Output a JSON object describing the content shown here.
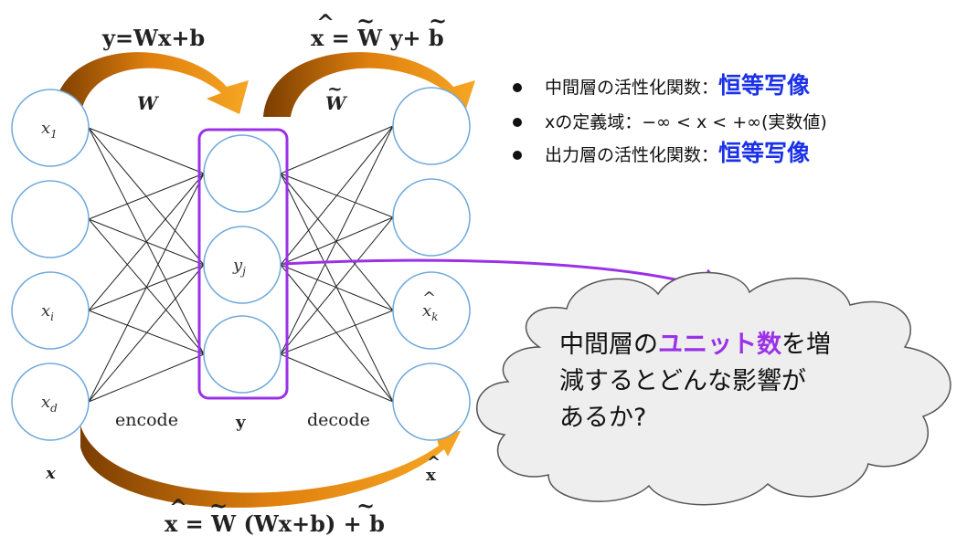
{
  "formulas": {
    "encode": "y=Wx+b",
    "decode_lhs": "x = W y+ b",
    "full": "x = W (Wx+b) + b"
  },
  "weights": {
    "encoder": "W",
    "decoder": "W"
  },
  "input_layer": {
    "nodes": [
      {
        "label": "x",
        "sub": "1"
      },
      {
        "label": "",
        "sub": ""
      },
      {
        "label": "x",
        "sub": "i"
      },
      {
        "label": "x",
        "sub": "d"
      }
    ],
    "name": "x"
  },
  "hidden_layer": {
    "nodes": [
      {
        "label": "",
        "sub": ""
      },
      {
        "label": "y",
        "sub": "j"
      },
      {
        "label": "",
        "sub": ""
      }
    ],
    "name": "y"
  },
  "output_layer": {
    "nodes": [
      {
        "label": "",
        "sub": ""
      },
      {
        "label": "",
        "sub": ""
      },
      {
        "label": "x",
        "sub": "k"
      },
      {
        "label": "",
        "sub": ""
      }
    ],
    "name": "x"
  },
  "section_labels": {
    "encode": "encode",
    "decode": "decode"
  },
  "bullets": [
    {
      "text": "中間層の活性化関数：",
      "highlight": "恒等写像"
    },
    {
      "text": "xの定義域：−∞ < x < +∞(実数値)",
      "highlight": ""
    },
    {
      "text": "出力層の活性化関数：",
      "highlight": "恒等写像"
    }
  ],
  "cloud": {
    "line1_pre": "中間層の",
    "line1_hl": "ユニット数",
    "line1_post": "を増",
    "line2": "減するとどんな影響が",
    "line3": "あるか?"
  },
  "colors": {
    "node_stroke": "#6fa8dc",
    "hidden_box": "#9b31e6",
    "arrow_orange": "#f39a1f",
    "highlight_blue": "#1a31e8",
    "cloud_fill": "#eeeeee"
  }
}
